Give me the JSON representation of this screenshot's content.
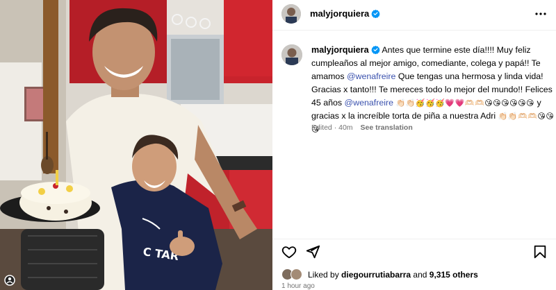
{
  "post": {
    "username": "malyjorquiera",
    "verified": true,
    "caption": {
      "text_1": "Antes que termine este día!!!! Muy feliz cumpleaños al mejor amigo, comediante, colega y papá!! Te amamos",
      "mention_1": "@wenafreire",
      "text_2": "Que tengas una hermosa y linda vida! Gracias x tanto!!! Te mereces todo lo mejor del mundo!! Felices 45 años",
      "mention_2": "@wenafreire",
      "emoji_1": "👏🏻👏🏻🥳🥳🥳💗💗🫶🏻🫶🏻😘😘😘😘😘😘",
      "text_3": "y gracias x la increíble torta de piña a nuestra Adri",
      "emoji_2": "👏🏻👏🏻🫶🏻🫶🏻😘😘😘"
    },
    "edited_label": "Edited",
    "edited_time": "40m",
    "see_translation": "See translation",
    "liked_by_prefix": "Liked by",
    "liked_by_user": "diegourrutiabarra",
    "liked_by_suffix": "and 9,315 others",
    "posted_time": "1 hour ago"
  },
  "icons": {
    "more": "more-options-icon",
    "like": "heart-icon",
    "share": "paper-plane-icon",
    "save": "bookmark-icon",
    "verified": "verified-badge-icon"
  },
  "colors": {
    "mention": "#3b52ae",
    "verified": "#0095f6",
    "muted": "#737373"
  }
}
